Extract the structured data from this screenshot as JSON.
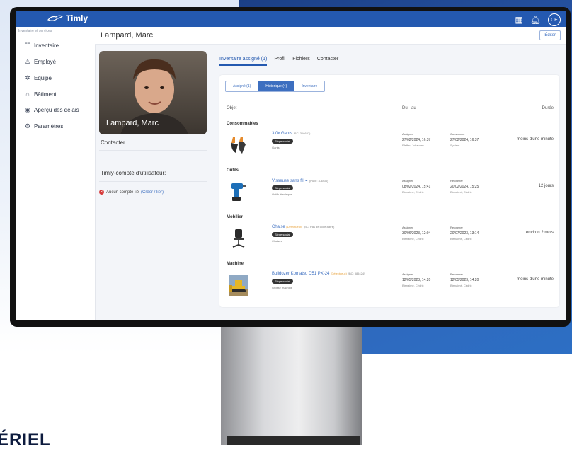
{
  "app": {
    "logo_text": "Timly"
  },
  "sidebar": {
    "search_placeholder": "Inventaire et services",
    "items": [
      {
        "label": "Inventaire",
        "icon": "inventory-icon"
      },
      {
        "label": "Employé",
        "icon": "user-icon"
      },
      {
        "label": "Equipe",
        "icon": "team-icon"
      },
      {
        "label": "Bâtiment",
        "icon": "building-icon"
      },
      {
        "label": "Aperçu des délais",
        "icon": "eye-icon"
      },
      {
        "label": "Paramètres",
        "icon": "gear-icon"
      }
    ]
  },
  "page": {
    "title": "Lampard, Marc",
    "edit_label": "Éditer"
  },
  "profile": {
    "photo_caption": "Lampard, Marc",
    "contact_label": "Contacter",
    "account_label": "Timly-compte d'utilisateur:",
    "no_account_text": "Aucun compte lié",
    "no_account_link": "(Créer / lier)"
  },
  "tabs": [
    {
      "label": "Inventaire assigné (1)",
      "active": true
    },
    {
      "label": "Profil",
      "active": false
    },
    {
      "label": "Fichiers",
      "active": false
    },
    {
      "label": "Contacter",
      "active": false
    }
  ],
  "subtabs": [
    {
      "label": "Assigné (1)",
      "active": false
    },
    {
      "label": "Historique (4)",
      "active": true
    },
    {
      "label": "Inventaire",
      "active": false
    }
  ],
  "table": {
    "col_object": "Objet",
    "col_period": "Du - au",
    "col_duration": "Durée",
    "rows": [
      {
        "category": "Consommables",
        "name": "3.0x Gants",
        "name_extra": "",
        "name_sub": "(BC: 316657)",
        "badge": "Siège social",
        "type": "Gants",
        "ev1_title": "Assigner",
        "ev1_date": "27/02/2024, 16:37",
        "ev1_by": "Pfeffer, Johannes",
        "ev2_title": "Consommé",
        "ev2_date": "27/02/2024, 16:37",
        "ev2_by": "System",
        "duration": "moins d'une minute"
      },
      {
        "category": "Outils",
        "name": "Visseuse sans fil ⚭",
        "name_extra": "",
        "name_sub": "(Puce: 4-4836)",
        "badge": "Siège social",
        "type": "Outils électrique",
        "ev1_title": "Assigner",
        "ev1_date": "08/02/2024, 15:41",
        "ev1_by": "Bienaimé, Cédric",
        "ev2_title": "Retourner",
        "ev2_date": "20/02/2024, 15:25",
        "ev2_by": "Bienaimé, Cédric",
        "duration": "12 jours"
      },
      {
        "category": "Mobilier",
        "name": "Chaise",
        "name_extra": "(Défectueux)",
        "name_sub": "(BC: Pas de code-barre)",
        "badge": "Siège social",
        "type": "Chaises",
        "ev1_title": "Assigner",
        "ev1_date": "30/06/2023, 12:04",
        "ev1_by": "Bienaimé, Cédric",
        "ev2_title": "Retourner",
        "ev2_date": "20/07/2023, 13:14",
        "ev2_by": "Bienaimé, Cédric",
        "duration": "environ 2 mois"
      },
      {
        "category": "Machine",
        "name": "Bulldozer Komatsu D51 PX-24",
        "name_extra": "(Défectueux)",
        "name_sub": "(BC: 385424)",
        "badge": "Siège social",
        "type": "Grosse machine",
        "ev1_title": "Assigner",
        "ev1_date": "12/05/2023, 14:20",
        "ev1_by": "Bienaimé, Cédric",
        "ev2_title": "Retourner",
        "ev2_date": "12/05/2023, 14:20",
        "ev2_by": "Bienaimé, Cédric",
        "duration": "moins d'une minute"
      }
    ]
  },
  "topbar": {
    "user_initials": "CE"
  },
  "marketing": {
    "partial_heading": "ÉRIEL"
  },
  "colors": {
    "primary": "#2459b0",
    "link": "#3d6fc0",
    "warning": "#e7a13a",
    "danger": "#d63b3b"
  }
}
